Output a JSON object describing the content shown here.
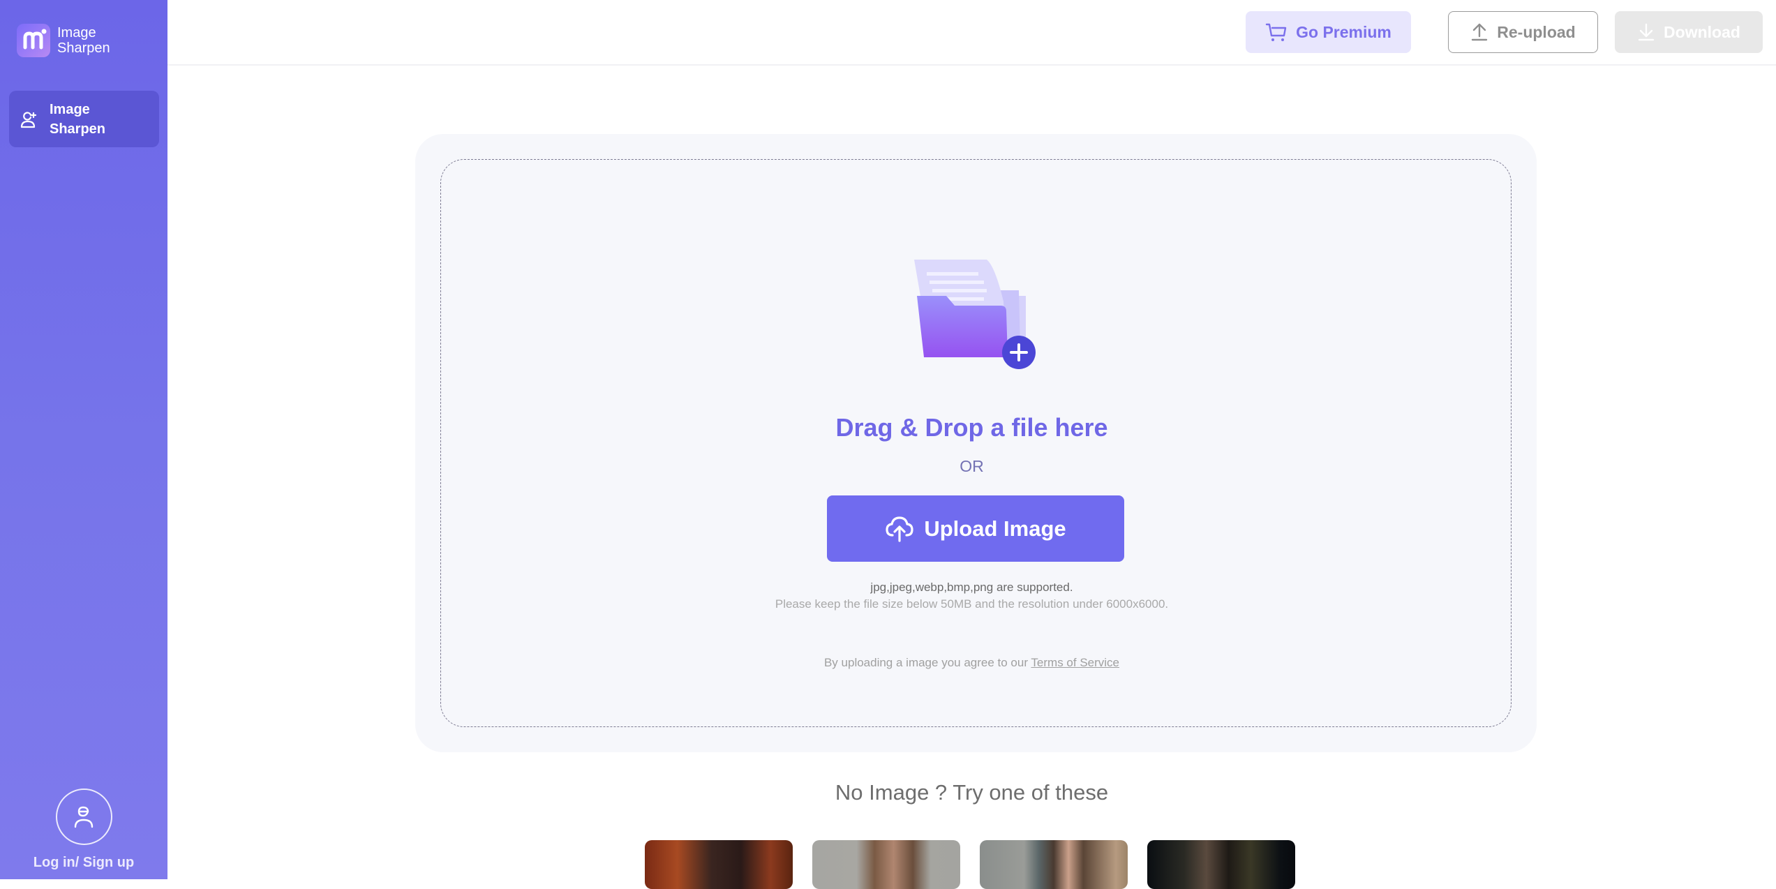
{
  "app": {
    "name_line1": "Image",
    "name_line2": "Sharpen",
    "brand_color": "#6c66e8",
    "accent_color": "#706bef"
  },
  "sidebar": {
    "items": [
      {
        "label_line1": "Image",
        "label_line2": "Sharpen",
        "icon": "user-plus-icon",
        "active": true
      }
    ],
    "account": {
      "icon": "user-icon",
      "label": "Log in/ Sign up"
    }
  },
  "header": {
    "premium_label": "Go Premium",
    "premium_icon": "cart-icon",
    "reupload_label": "Re-upload",
    "reupload_icon": "upload-arrow-icon",
    "download_label": "Download",
    "download_icon": "download-arrow-icon",
    "download_disabled": true
  },
  "upload": {
    "icon": "folder-add-icon",
    "drag_title": "Drag & Drop a file here",
    "or_text": "OR",
    "button_label": "Upload Image",
    "button_icon": "cloud-upload-icon",
    "formats_text": "jpg,jpeg,webp,bmp,png are supported.",
    "limits_text": "Please keep the file size below 50MB and the resolution under 6000x6000.",
    "terms_prefix": "By uploading a image you agree to our ",
    "terms_link": "Terms of Service"
  },
  "samples": {
    "title": "No Image ? Try one of these",
    "items": [
      {
        "alt": "woman with dark curly hair"
      },
      {
        "alt": "man with short brown hair"
      },
      {
        "alt": "woman with long hair"
      },
      {
        "alt": "man in dark lighting"
      }
    ]
  }
}
